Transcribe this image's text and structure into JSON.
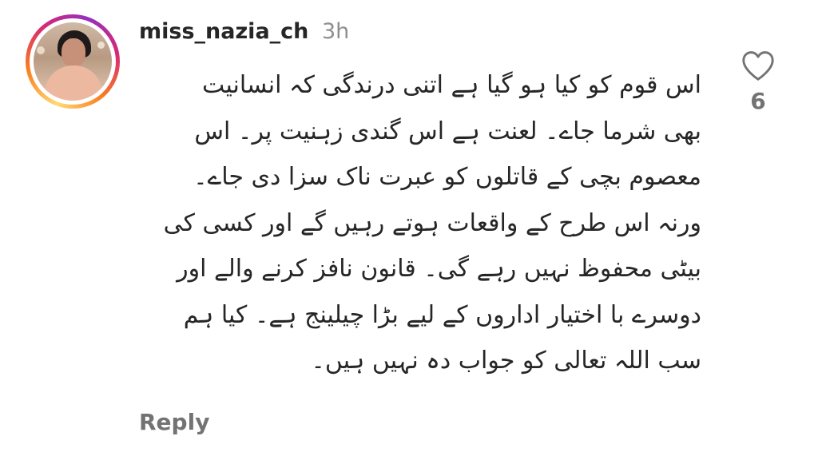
{
  "comment": {
    "username": "miss_nazia_ch",
    "time": "3h",
    "lines": [
      "اس قوم کو کیا ہو گیا ہے اتنی درندگی کہ انسانیت",
      "بھی شرما جاے۔ لعنت ہے اس گندی زہنیت پر۔ اس",
      "معصوم بچی کے قاتلوں کو عبرت ناک سزا دی جاے۔",
      "ورنہ اس طرح کے واقعات ہوتے رہیں گے اور کسی کی",
      "بیٹی محفوظ نہیں رہے گی۔ قانون نافز کرنے والے اور",
      "دوسرے با اختیار اداروں کے لیے بڑا چیلینج ہے۔ کیا ہم",
      "سب اللہ تعالی کو جواب دہ نہیں ہیں۔"
    ],
    "reply_label": "Reply",
    "like_count": "6",
    "icons": {
      "like": "heart-outline-icon",
      "avatar": "user-avatar"
    },
    "colors": {
      "text": "#262626",
      "secondary": "#8e8e8e",
      "action": "#737373"
    }
  }
}
